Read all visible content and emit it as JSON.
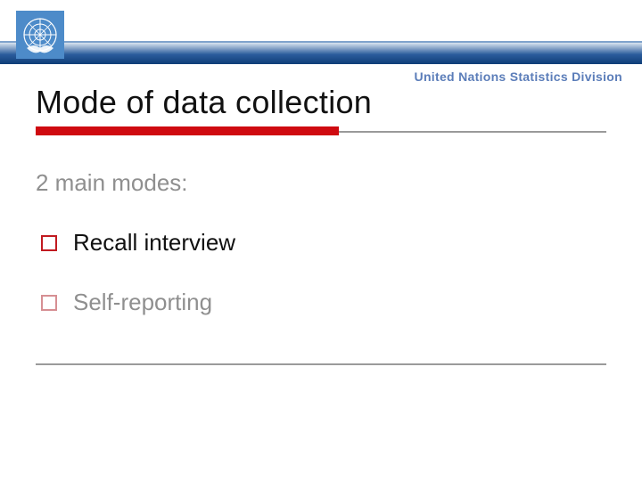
{
  "header": {
    "org_label": "United Nations Statistics Division"
  },
  "slide": {
    "title": "Mode of data collection",
    "intro": "2 main modes:",
    "bullets": [
      {
        "label": "Recall interview"
      },
      {
        "label": "Self-reporting"
      }
    ]
  }
}
